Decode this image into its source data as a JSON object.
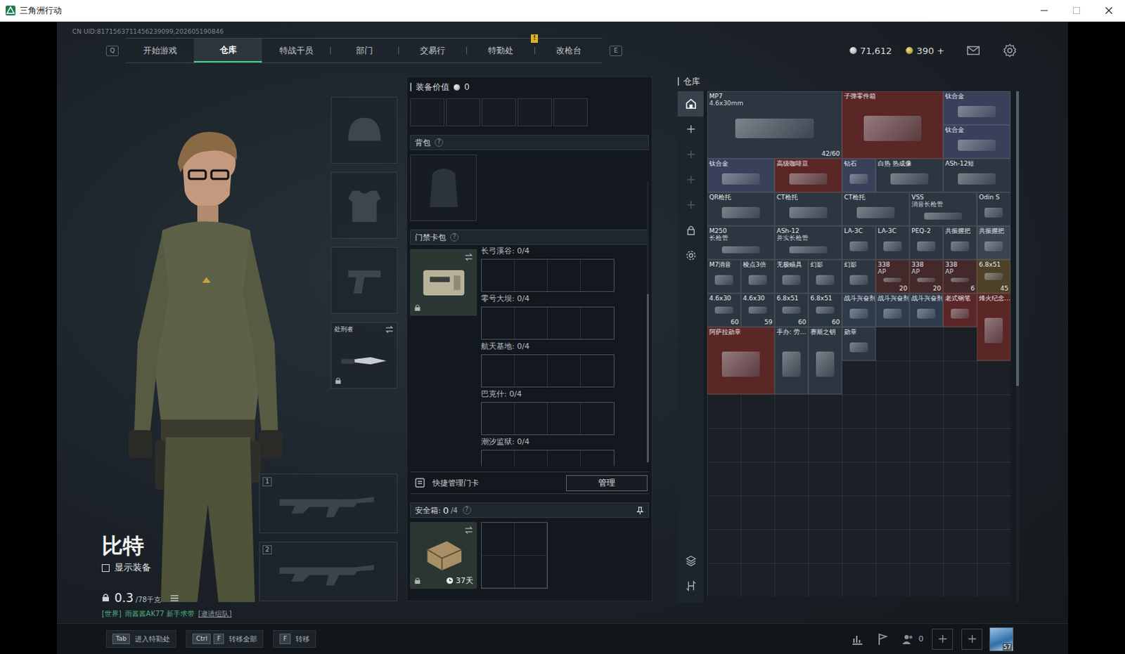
{
  "window": {
    "title": "三角洲行动",
    "controls": [
      {
        "kind": "minimize",
        "disabled": false
      },
      {
        "kind": "maximize",
        "disabled": true
      },
      {
        "kind": "close",
        "disabled": false
      }
    ]
  },
  "header": {
    "uid": "CN UID:8171563711456239099,202605190846",
    "currency": [
      {
        "value": "71,612",
        "kind": "silver"
      },
      {
        "value": "390 +",
        "kind": "gold"
      }
    ]
  },
  "nav": {
    "left_key": "Q",
    "right_key": "E",
    "tabs": [
      {
        "label": "开始游戏",
        "selected": false
      },
      {
        "label": "仓库",
        "selected": true
      },
      {
        "label": "特战干员",
        "selected": false
      },
      {
        "label": "部门",
        "selected": false
      },
      {
        "label": "交易行",
        "selected": false
      },
      {
        "label": "特勤处",
        "selected": false,
        "badge": "!"
      },
      {
        "label": "改枪台",
        "selected": false
      }
    ]
  },
  "operator": {
    "name": "比特",
    "show_equipment": {
      "label": "显示装备",
      "checked": false
    },
    "weight": {
      "value": "0.3",
      "max": "/78千克"
    },
    "chat": {
      "channel": "[世界]",
      "text": "雨酱酱AK77 新手求带",
      "link": "[邀请组队]"
    }
  },
  "equipment_slots": [
    {
      "kind": "helmet",
      "locked": false
    },
    {
      "kind": "armor",
      "locked": false
    },
    {
      "kind": "pistol",
      "locked": false
    },
    {
      "kind": "melee",
      "label": "处刑者",
      "locked": true
    }
  ],
  "weapon_slots": [
    {
      "number": "1"
    },
    {
      "number": "2"
    }
  ],
  "loadout": {
    "value_label": "装备价值",
    "value": "0",
    "backpack": {
      "title": "背包",
      "help": "?"
    },
    "keycards": {
      "title": "门禁卡包",
      "help": "?",
      "locked": true,
      "maps": [
        {
          "name": "长弓溪谷: 0/4"
        },
        {
          "name": "零号大坝: 0/4"
        },
        {
          "name": "航天基地: 0/4"
        },
        {
          "name": "巴克什: 0/4"
        },
        {
          "name": "潮汐监狱: 0/4"
        }
      ],
      "quick_manage": "快捷管理门卡",
      "manage_button": "管理"
    },
    "safe_box": {
      "title": "安全箱:",
      "count": "0",
      "capacity": "/4",
      "help": "?",
      "days": "37天",
      "locked": true
    }
  },
  "warehouse": {
    "title": "仓库",
    "toolbar": [
      {
        "kind": "home",
        "selected": true,
        "disabled": false
      },
      {
        "kind": "add",
        "selected": false,
        "disabled": false
      },
      {
        "kind": "add",
        "selected": false,
        "disabled": true
      },
      {
        "kind": "add",
        "selected": false,
        "disabled": true
      },
      {
        "kind": "add",
        "selected": false,
        "disabled": true
      },
      {
        "kind": "lock",
        "selected": false,
        "disabled": false
      },
      {
        "kind": "settings",
        "selected": false,
        "disabled": false
      }
    ],
    "bottom_tools": [
      {
        "kind": "layers"
      },
      {
        "kind": "sort"
      }
    ],
    "items": [
      {
        "name": "MP7",
        "sub": "4.6x30mm",
        "count": "42/60",
        "color": "#2c3640"
      },
      {
        "name": "子弹零件箱",
        "color": "#5a2626"
      },
      {
        "name": "钛合金",
        "color": "#38405a"
      },
      {
        "name": "钛合金",
        "color": "#38405a"
      },
      {
        "name": "钛合金",
        "color": "#38405a"
      },
      {
        "name": "高级咖啡豆",
        "color": "#5a2626"
      },
      {
        "name": "钻石",
        "color": "#38405a"
      },
      {
        "name": "白热 热成像",
        "color": "#2c3640"
      },
      {
        "name": "ASh-12短",
        "color": "#2c3640"
      },
      {
        "name": "QR枪托",
        "color": "#2c3640"
      },
      {
        "name": "CT枪托",
        "color": "#2c3640"
      },
      {
        "name": "CT枪托",
        "color": "#2c3640"
      },
      {
        "name": "VSS",
        "sub": "消音长枪管",
        "color": "#2c3640"
      },
      {
        "name": "Odin S",
        "color": "#2c3640"
      },
      {
        "name": "M250",
        "sub": "长枪管",
        "color": "#2c3640"
      },
      {
        "name": "ASh-12",
        "sub": "并实长枪管",
        "color": "#2c3640"
      },
      {
        "name": "LA-3C",
        "color": "#2c3640"
      },
      {
        "name": "LA-3C",
        "color": "#2c3640"
      },
      {
        "name": "PEQ-2",
        "color": "#2c3640"
      },
      {
        "name": "共振握把",
        "color": "#2c3640"
      },
      {
        "name": "共振握把",
        "color": "#3a4350"
      },
      {
        "name": "M7消音",
        "color": "#2c3640"
      },
      {
        "name": "棱点3倍",
        "color": "#2c3640"
      },
      {
        "name": "无极瞄具",
        "color": "#2c3640"
      },
      {
        "name": "幻影",
        "color": "#2c3640"
      },
      {
        "name": "幻影",
        "color": "#2c3640"
      },
      {
        "name": "338",
        "sub": "AP",
        "count": "20",
        "color": "#44292a"
      },
      {
        "name": "338",
        "sub": "AP",
        "count": "20",
        "color": "#44292a"
      },
      {
        "name": "338",
        "sub": "AP",
        "count": "6",
        "color": "#44292a"
      },
      {
        "name": "6.8x51",
        "count": "45",
        "color": "#4d4128"
      },
      {
        "name": "4.6x30",
        "count": "60",
        "color": "#2c3640"
      },
      {
        "name": "4.6x30",
        "count": "59",
        "color": "#2c3640"
      },
      {
        "name": "6.8x51",
        "count": "60",
        "color": "#2c3640"
      },
      {
        "name": "6.8x51",
        "count": "60",
        "color": "#2c3640"
      },
      {
        "name": "战斗兴奋剂",
        "color": "#2f3a4a"
      },
      {
        "name": "战斗兴奋剂",
        "color": "#2f3a4a"
      },
      {
        "name": "战斗兴奋剂",
        "color": "#2f3a4a"
      },
      {
        "name": "老式钢笔",
        "color": "#5a2626"
      },
      {
        "name": "烽火纪念…",
        "color": "#5a2626"
      },
      {
        "name": "阿萨拉勋章",
        "color": "#5a2626"
      },
      {
        "name": "手办: 劳…",
        "color": "#2c3640"
      },
      {
        "name": "赛斯之钥",
        "color": "#2c3640"
      },
      {
        "name": "勋章",
        "color": "#2c3640"
      }
    ]
  },
  "bottom_bar": {
    "hints": [
      {
        "keys": [
          "Tab"
        ],
        "label": "进入特勤处"
      },
      {
        "keys": [
          "Ctrl",
          "F"
        ],
        "label": "转移全部"
      },
      {
        "keys": [
          "F"
        ],
        "label": "转移"
      }
    ],
    "friends": "0",
    "avatar_level": "57"
  }
}
